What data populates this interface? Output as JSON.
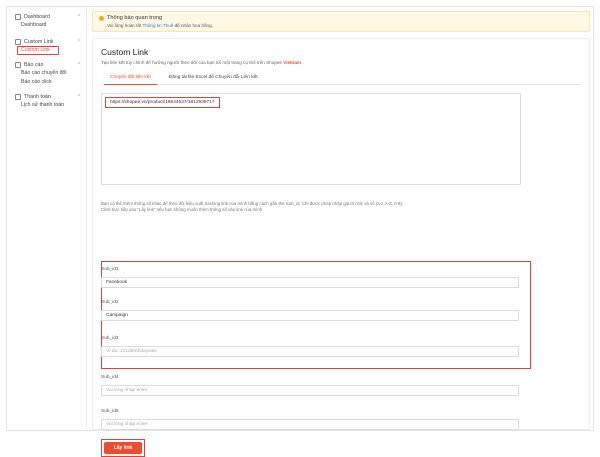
{
  "sidebar": {
    "groups": [
      {
        "label": "Dashboard",
        "items": [
          "Dashboard"
        ]
      },
      {
        "label": "Custom Link",
        "items": [
          "Custom Link"
        ]
      },
      {
        "label": "Báo cáo",
        "items": [
          "Báo cáo chuyển đổi",
          "Báo cáo click"
        ]
      },
      {
        "label": "Thanh toán",
        "items": [
          "Lịch sử thanh toán"
        ]
      }
    ]
  },
  "notice": {
    "title": "Thông báo quan trọng",
    "body_prefix": "Vui lòng hoàn tất ",
    "body_link": "Thông tin Thuế",
    "body_suffix": " để nhận hoa hồng."
  },
  "page": {
    "title": "Custom Link",
    "subtitle_prefix": "Tạo liên kết tùy chỉnh để hướng người theo dõi của bạn tới một trang cụ thể trên Shopee ",
    "subtitle_brand": "Vietnam",
    "tabs": [
      "Chuyển đổi liên kết",
      "Đăng tải file Excel để Chuyển đổi Liên kết"
    ],
    "link_value": "https://shopee.vn/product/18644537/1812939717",
    "hint_line1": "Bạn có thể thêm thông số khác để theo dõi hiệu suất tracking link của mình bằng cách gắn thẻ Sub_id. Chỉ được phép nhập giá trị chữ và số (a-z,A-Z, 0-9).",
    "hint_line2": "Click trực tiếp vào \"Lấy link\" nếu bạn không muốn thêm thông số vào link của mình"
  },
  "subids": [
    {
      "label": "Sub_id1",
      "value": "Facebook",
      "placeholder": ""
    },
    {
      "label": "Sub_id2",
      "value": "Campaign",
      "placeholder": ""
    },
    {
      "label": "Sub_id3",
      "value": "",
      "placeholder": "Ví dụ: 1212Birthdaysale"
    },
    {
      "label": "Sub_id4",
      "value": "",
      "placeholder": "Vui lòng nhập enter"
    },
    {
      "label": "Sub_id5",
      "value": "",
      "placeholder": "Vui lòng nhập enter"
    }
  ],
  "button": {
    "label": "Lấy link"
  },
  "colors": {
    "accent": "#ee4d2d",
    "highlight": "#e0413f",
    "notice_bg": "#fff8e4",
    "link": "#2f7bd8"
  }
}
